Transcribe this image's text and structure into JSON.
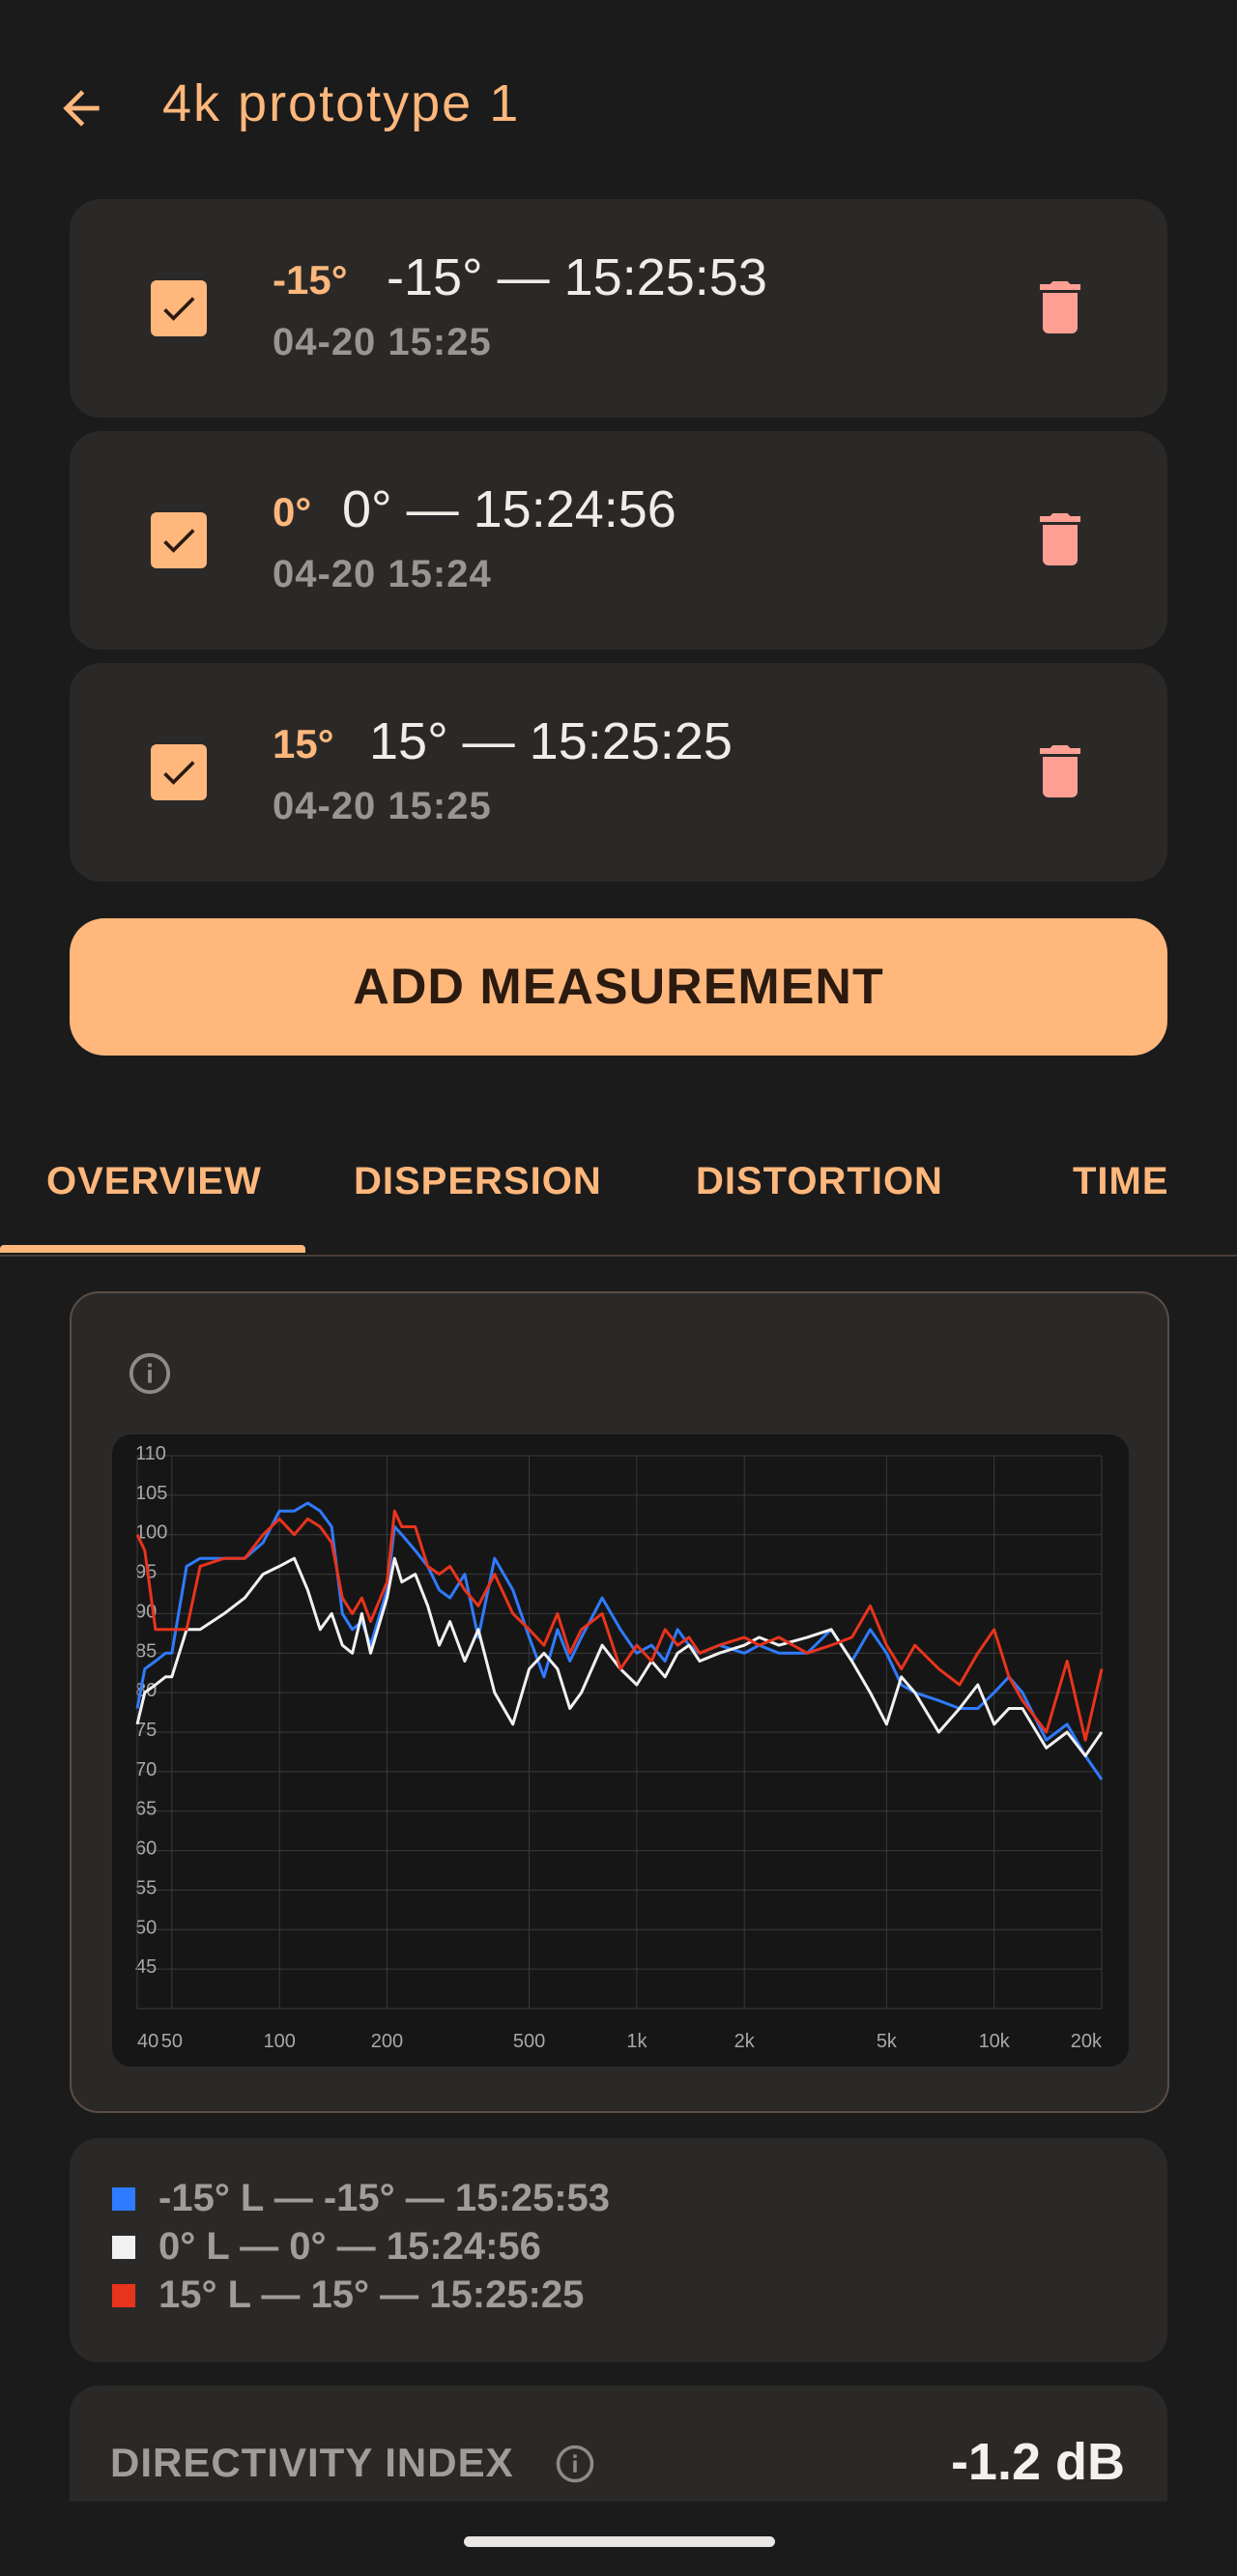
{
  "header": {
    "title": "4k prototype 1",
    "back_icon": "arrow-back-icon"
  },
  "measurements": [
    {
      "angle": "-15°",
      "title": "-15° — 15:25:53",
      "date": "04-20 15:25",
      "checked": true
    },
    {
      "angle": "0°",
      "title": "0° — 15:24:56",
      "date": "04-20 15:24",
      "checked": true
    },
    {
      "angle": "15°",
      "title": "15° — 15:25:25",
      "date": "04-20 15:25",
      "checked": true
    }
  ],
  "add_button_label": "ADD MEASUREMENT",
  "tabs": [
    {
      "label": "OVERVIEW",
      "selected": true
    },
    {
      "label": "DISPERSION",
      "selected": false
    },
    {
      "label": "DISTORTION",
      "selected": false
    },
    {
      "label": "TIME",
      "selected": false
    }
  ],
  "chart_data": {
    "type": "line",
    "x_scale": "log",
    "x_ticks": [
      "40",
      "50",
      "100",
      "200",
      "500",
      "1k",
      "2k",
      "5k",
      "10k",
      "20k"
    ],
    "x_tick_values": [
      40,
      50,
      100,
      200,
      500,
      1000,
      2000,
      5000,
      10000,
      20000
    ],
    "y_ticks": [
      110,
      105,
      100,
      95,
      90,
      85,
      80,
      75,
      70,
      65,
      60,
      55,
      50,
      45,
      40
    ],
    "ylim": [
      40,
      110
    ],
    "xlim": [
      40,
      20000
    ],
    "grid": true,
    "series": [
      {
        "name": "-15° L — -15° — 15:25:53",
        "color": "#2f7bff",
        "x": [
          40,
          42,
          45,
          48,
          50,
          55,
          60,
          70,
          80,
          90,
          100,
          110,
          120,
          130,
          140,
          150,
          160,
          170,
          180,
          200,
          210,
          220,
          240,
          260,
          280,
          300,
          330,
          360,
          400,
          450,
          500,
          550,
          600,
          650,
          700,
          800,
          900,
          1000,
          1100,
          1200,
          1300,
          1400,
          1500,
          1700,
          2000,
          2200,
          2500,
          3000,
          3500,
          4000,
          4500,
          5000,
          5500,
          6000,
          7000,
          8000,
          9000,
          10000,
          11000,
          12000,
          14000,
          16000,
          18000,
          20000
        ],
        "y": [
          78,
          83,
          84,
          85,
          85,
          96,
          97,
          97,
          97,
          99,
          103,
          103,
          104,
          103,
          101,
          90,
          88,
          89,
          86,
          93,
          101,
          100,
          98,
          96,
          93,
          92,
          95,
          87,
          97,
          93,
          87,
          82,
          88,
          84,
          87,
          92,
          88,
          85,
          86,
          84,
          88,
          86,
          85,
          86,
          85,
          86,
          85,
          85,
          88,
          84,
          88,
          85,
          81,
          80,
          79,
          78,
          78,
          80,
          82,
          80,
          74,
          76,
          72,
          69
        ]
      },
      {
        "name": "0° L — 0° — 15:24:56",
        "color": "#f1f1f1",
        "x": [
          40,
          42,
          45,
          48,
          50,
          55,
          60,
          70,
          80,
          90,
          100,
          110,
          120,
          130,
          140,
          150,
          160,
          170,
          180,
          200,
          210,
          220,
          240,
          260,
          280,
          300,
          330,
          360,
          400,
          450,
          500,
          550,
          600,
          650,
          700,
          800,
          900,
          1000,
          1100,
          1200,
          1300,
          1400,
          1500,
          1700,
          2000,
          2200,
          2500,
          3000,
          3500,
          4000,
          4500,
          5000,
          5500,
          6000,
          7000,
          8000,
          9000,
          10000,
          11000,
          12000,
          14000,
          16000,
          18000,
          20000
        ],
        "y": [
          76,
          80,
          81,
          82,
          82,
          88,
          88,
          90,
          92,
          95,
          96,
          97,
          93,
          88,
          90,
          86,
          85,
          90,
          85,
          92,
          97,
          94,
          95,
          91,
          86,
          89,
          84,
          88,
          80,
          76,
          83,
          85,
          83,
          78,
          80,
          86,
          83,
          81,
          84,
          82,
          85,
          86,
          84,
          85,
          86,
          87,
          86,
          87,
          88,
          84,
          80,
          76,
          82,
          80,
          75,
          78,
          81,
          76,
          78,
          78,
          73,
          75,
          72,
          75
        ]
      },
      {
        "name": "15° L — 15° — 15:25:25",
        "color": "#e8341c",
        "x": [
          40,
          42,
          45,
          48,
          50,
          55,
          60,
          70,
          80,
          90,
          100,
          110,
          120,
          130,
          140,
          150,
          160,
          170,
          180,
          200,
          210,
          220,
          240,
          260,
          280,
          300,
          330,
          360,
          400,
          450,
          500,
          550,
          600,
          650,
          700,
          800,
          900,
          1000,
          1100,
          1200,
          1300,
          1400,
          1500,
          1700,
          2000,
          2200,
          2500,
          3000,
          3500,
          4000,
          4500,
          5000,
          5500,
          6000,
          7000,
          8000,
          9000,
          10000,
          11000,
          12000,
          14000,
          16000,
          18000,
          20000
        ],
        "y": [
          100,
          98,
          88,
          88,
          88,
          88,
          96,
          97,
          97,
          100,
          102,
          100,
          102,
          101,
          99,
          92,
          90,
          92,
          89,
          94,
          103,
          101,
          101,
          96,
          95,
          96,
          93,
          91,
          95,
          90,
          88,
          86,
          90,
          85,
          88,
          90,
          83,
          86,
          84,
          88,
          86,
          87,
          85,
          86,
          87,
          86,
          87,
          85,
          86,
          87,
          91,
          86,
          83,
          86,
          83,
          81,
          85,
          88,
          82,
          79,
          75,
          84,
          74,
          83
        ]
      }
    ]
  },
  "legend": [
    {
      "color": "#2f7bff",
      "label": "-15° L — -15° — 15:25:53"
    },
    {
      "color": "#f1f1f1",
      "label": "0° L — 0° — 15:24:56"
    },
    {
      "color": "#e8341c",
      "label": "15° L — 15° — 15:25:25"
    }
  ],
  "directivity": {
    "label": "DIRECTIVITY INDEX",
    "value": "-1.2 dB"
  },
  "colors": {
    "accent": "#ffb77c",
    "surface": "#2b2928",
    "background": "#1b1b1b",
    "trash": "#ff9f94"
  }
}
